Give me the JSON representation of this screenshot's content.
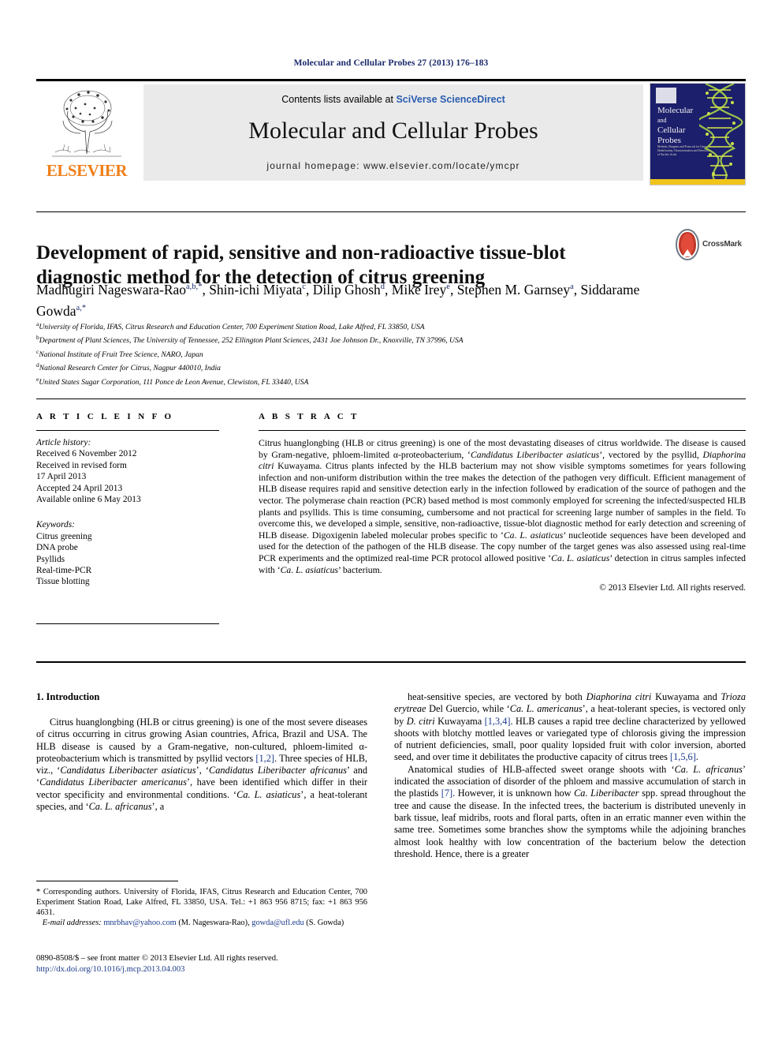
{
  "running_head": "Molecular and Cellular Probes 27 (2013) 176–183",
  "masthead": {
    "publisher_name": "ELSEVIER",
    "contents_line_prefix": "Contents lists available at ",
    "contents_line_brand": "SciVerse ScienceDirect",
    "journal_title": "Molecular and Cellular Probes",
    "homepage": "journal homepage: www.elsevier.com/locate/ymcpr",
    "cover": {
      "title_line1": "Molecular",
      "title_line2": "and",
      "title_line3": "Cellular",
      "title_line4": "Probes",
      "blurb": "Methods, Reagents and Protocols for Gene Identification, Characterization and Detection of Nucleic Acids",
      "background_color": "#1c1f6b",
      "accent_color": "#f0c419"
    }
  },
  "article": {
    "title": "Development of rapid, sensitive and non-radioactive tissue-blot diagnostic method for the detection of citrus greening",
    "crossmark_label": "CrossMark",
    "authors_html": "Madhugiri Nageswara-Rao<sup>a,b,</sup><sup>*</sup>, Shin-ichi Miyata<sup>c</sup>, Dilip Ghosh<sup>d</sup>, Mike Irey<sup>e</sup>, Stephen M. Garnsey<sup>a</sup>, Siddarame Gowda<sup>a,</sup><sup>*</sup>",
    "affiliations": [
      {
        "marker": "a",
        "text": "University of Florida, IFAS, Citrus Research and Education Center, 700 Experiment Station Road, Lake Alfred, FL 33850, USA"
      },
      {
        "marker": "b",
        "text": "Department of Plant Sciences, The University of Tennessee, 252 Ellington Plant Sciences, 2431 Joe Johnson Dr., Knoxville, TN 37996, USA"
      },
      {
        "marker": "c",
        "text": "National Institute of Fruit Tree Science, NARO, Japan"
      },
      {
        "marker": "d",
        "text": "National Research Center for Citrus, Nagpur 440010, India"
      },
      {
        "marker": "e",
        "text": "United States Sugar Corporation, 111 Ponce de Leon Avenue, Clewiston, FL 33440, USA"
      }
    ]
  },
  "article_info": {
    "heading": "A R T I C L E   I N F O",
    "history_label": "Article history:",
    "history": [
      "Received 6 November 2012",
      "Received in revised form",
      "17 April 2013",
      "Accepted 24 April 2013",
      "Available online 6 May 2013"
    ],
    "keywords_label": "Keywords:",
    "keywords": [
      "Citrus greening",
      "DNA probe",
      "Psyllids",
      "Real-time-PCR",
      "Tissue blotting"
    ]
  },
  "abstract": {
    "heading": "A B S T R A C T",
    "text_html": "Citrus huanglongbing (HLB or citrus greening) is one of the most devastating diseases of citrus worldwide. The disease is caused by Gram-negative, phloem-limited &alpha;-proteobacterium, &lsquo;<span class=\"ital\">Candidatus Liberibacter asiaticus</span>&rsquo;, vectored by the psyllid, <span class=\"ital\">Diaphorina citri</span> Kuwayama. Citrus plants infected by the HLB bacterium may not show visible symptoms sometimes for years following infection and non-uniform distribution within the tree makes the detection of the pathogen very difficult. Efficient management of HLB disease requires rapid and sensitive detection early in the infection followed by eradication of the source of pathogen and the vector. The polymerase chain reaction (PCR) based method is most commonly employed for screening the infected/suspected HLB plants and psyllids. This is time consuming, cumbersome and not practical for screening large number of samples in the field. To overcome this, we developed a simple, sensitive, non-radioactive, tissue-blot diagnostic method for early detection and screening of HLB disease. Digoxigenin labeled molecular probes specific to &lsquo;<span class=\"ital\">Ca</span>. <span class=\"ital\">L. asiaticus</span>&rsquo; nucleotide sequences have been developed and used for the detection of the pathogen of the HLB disease. The copy number of the target genes was also assessed using real-time PCR experiments and the optimized real-time PCR protocol allowed positive &lsquo;<span class=\"ital\">Ca</span>. <span class=\"ital\">L. asiaticus</span>&rsquo; detection in citrus samples infected with &lsquo;<span class=\"ital\">Ca</span>. <span class=\"ital\">L. asiaticus</span>&rsquo; bacterium.",
    "copyright": "© 2013 Elsevier Ltd. All rights reserved."
  },
  "body": {
    "section_number_title": "1.  Introduction",
    "left_paragraph_html": "Citrus huanglongbing (HLB or citrus greening) is one of the most severe diseases of citrus occurring in citrus growing Asian countries, Africa, Brazil and USA. The HLB disease is caused by a Gram-negative, non-cultured, phloem-limited &alpha;-proteobacterium which is transmitted by psyllid vectors <span class=\"ref\">[1,2]</span>. Three species of HLB, viz., &lsquo;<span class=\"ital\">Candidatus Liberibacter asiaticus</span>&rsquo;, &lsquo;<span class=\"ital\">Candidatus Liberibacter africanus</span>&rsquo; and &lsquo;<span class=\"ital\">Candidatus Liberibacter americanus</span>&rsquo;, have been identified which differ in their vector specificity and environmental conditions. &lsquo;<span class=\"ital\">Ca. L. asiaticus</span>&rsquo;, a heat-tolerant species, and &lsquo;<span class=\"ital\">Ca. L. africanus</span>&rsquo;, a",
    "right_paragraph_1_html": "heat-sensitive species, are vectored by both <span class=\"ital\">Diaphorina citri</span> Kuwayama and <span class=\"ital\">Trioza erytreae</span> Del Guercio, while &lsquo;<span class=\"ital\">Ca. L. americanus</span>&rsquo;, a heat-tolerant species, is vectored only by <span class=\"ital\">D. citri</span> Kuwayama <span class=\"ref\">[1,3,4]</span>. HLB causes a rapid tree decline characterized by yellowed shoots with blotchy mottled leaves or variegated type of chlorosis giving the impression of nutrient deficiencies, small, poor quality lopsided fruit with color inversion, aborted seed, and over time it debilitates the productive capacity of citrus trees <span class=\"ref\">[1,5,6]</span>.",
    "right_paragraph_2_html": "Anatomical studies of HLB-affected sweet orange shoots with &lsquo;<span class=\"ital\">Ca. L. africanus</span>&rsquo; indicated the association of disorder of the phloem and massive accumulation of starch in the plastids <span class=\"ref\">[7]</span>. However, it is unknown how <span class=\"ital\">Ca. Liberibacter</span> spp. spread throughout the tree and cause the disease. In the infected trees, the bacterium is distributed unevenly in bark tissue, leaf midribs, roots and floral parts, often in an erratic manner even within the same tree. Sometimes some branches show the symptoms while the adjoining branches almost look healthy with low concentration of the bacterium below the detection threshold. Hence, there is a greater"
  },
  "footnotes": {
    "corresponding_html": "* Corresponding authors. University of Florida, IFAS, Citrus Research and Education Center, 700 Experiment Station Road, Lake Alfred, FL 33850, USA. Tel.: +1 863 956 8715; fax: +1 863 956 4631.",
    "email_label": "E-mail addresses:",
    "emails": [
      {
        "address": "mnrbhav@yahoo.com",
        "owner": "(M. Nageswara-Rao)"
      },
      {
        "address": "gowda@ufl.edu",
        "owner": "(S. Gowda)"
      }
    ],
    "issn_line": "0890-8508/$ – see front matter © 2013 Elsevier Ltd. All rights reserved.",
    "doi": "http://dx.doi.org/10.1016/j.mcp.2013.04.003"
  }
}
